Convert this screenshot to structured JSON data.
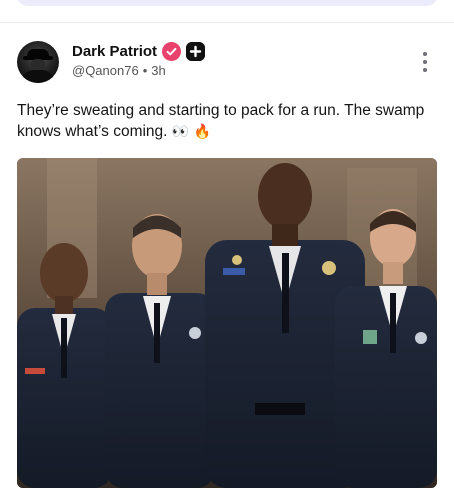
{
  "post": {
    "author_name": "Dark Patriot",
    "handle": "@Qanon76",
    "separator": "•",
    "time_ago": "3h",
    "text": "They’re sweating and starting to pack for a run. The swamp knows what’s coming.",
    "emoji_eyes": "👀",
    "emoji_fire": "🔥"
  },
  "icons": {
    "verified": "verified-badge-icon",
    "plus": "plus-badge-icon",
    "more": "more-vertical-icon"
  },
  "colors": {
    "verified_badge": "#e9436d",
    "plus_badge": "#111111",
    "top_bar": "#ecebfb",
    "police_uniform": "#1b2233"
  }
}
